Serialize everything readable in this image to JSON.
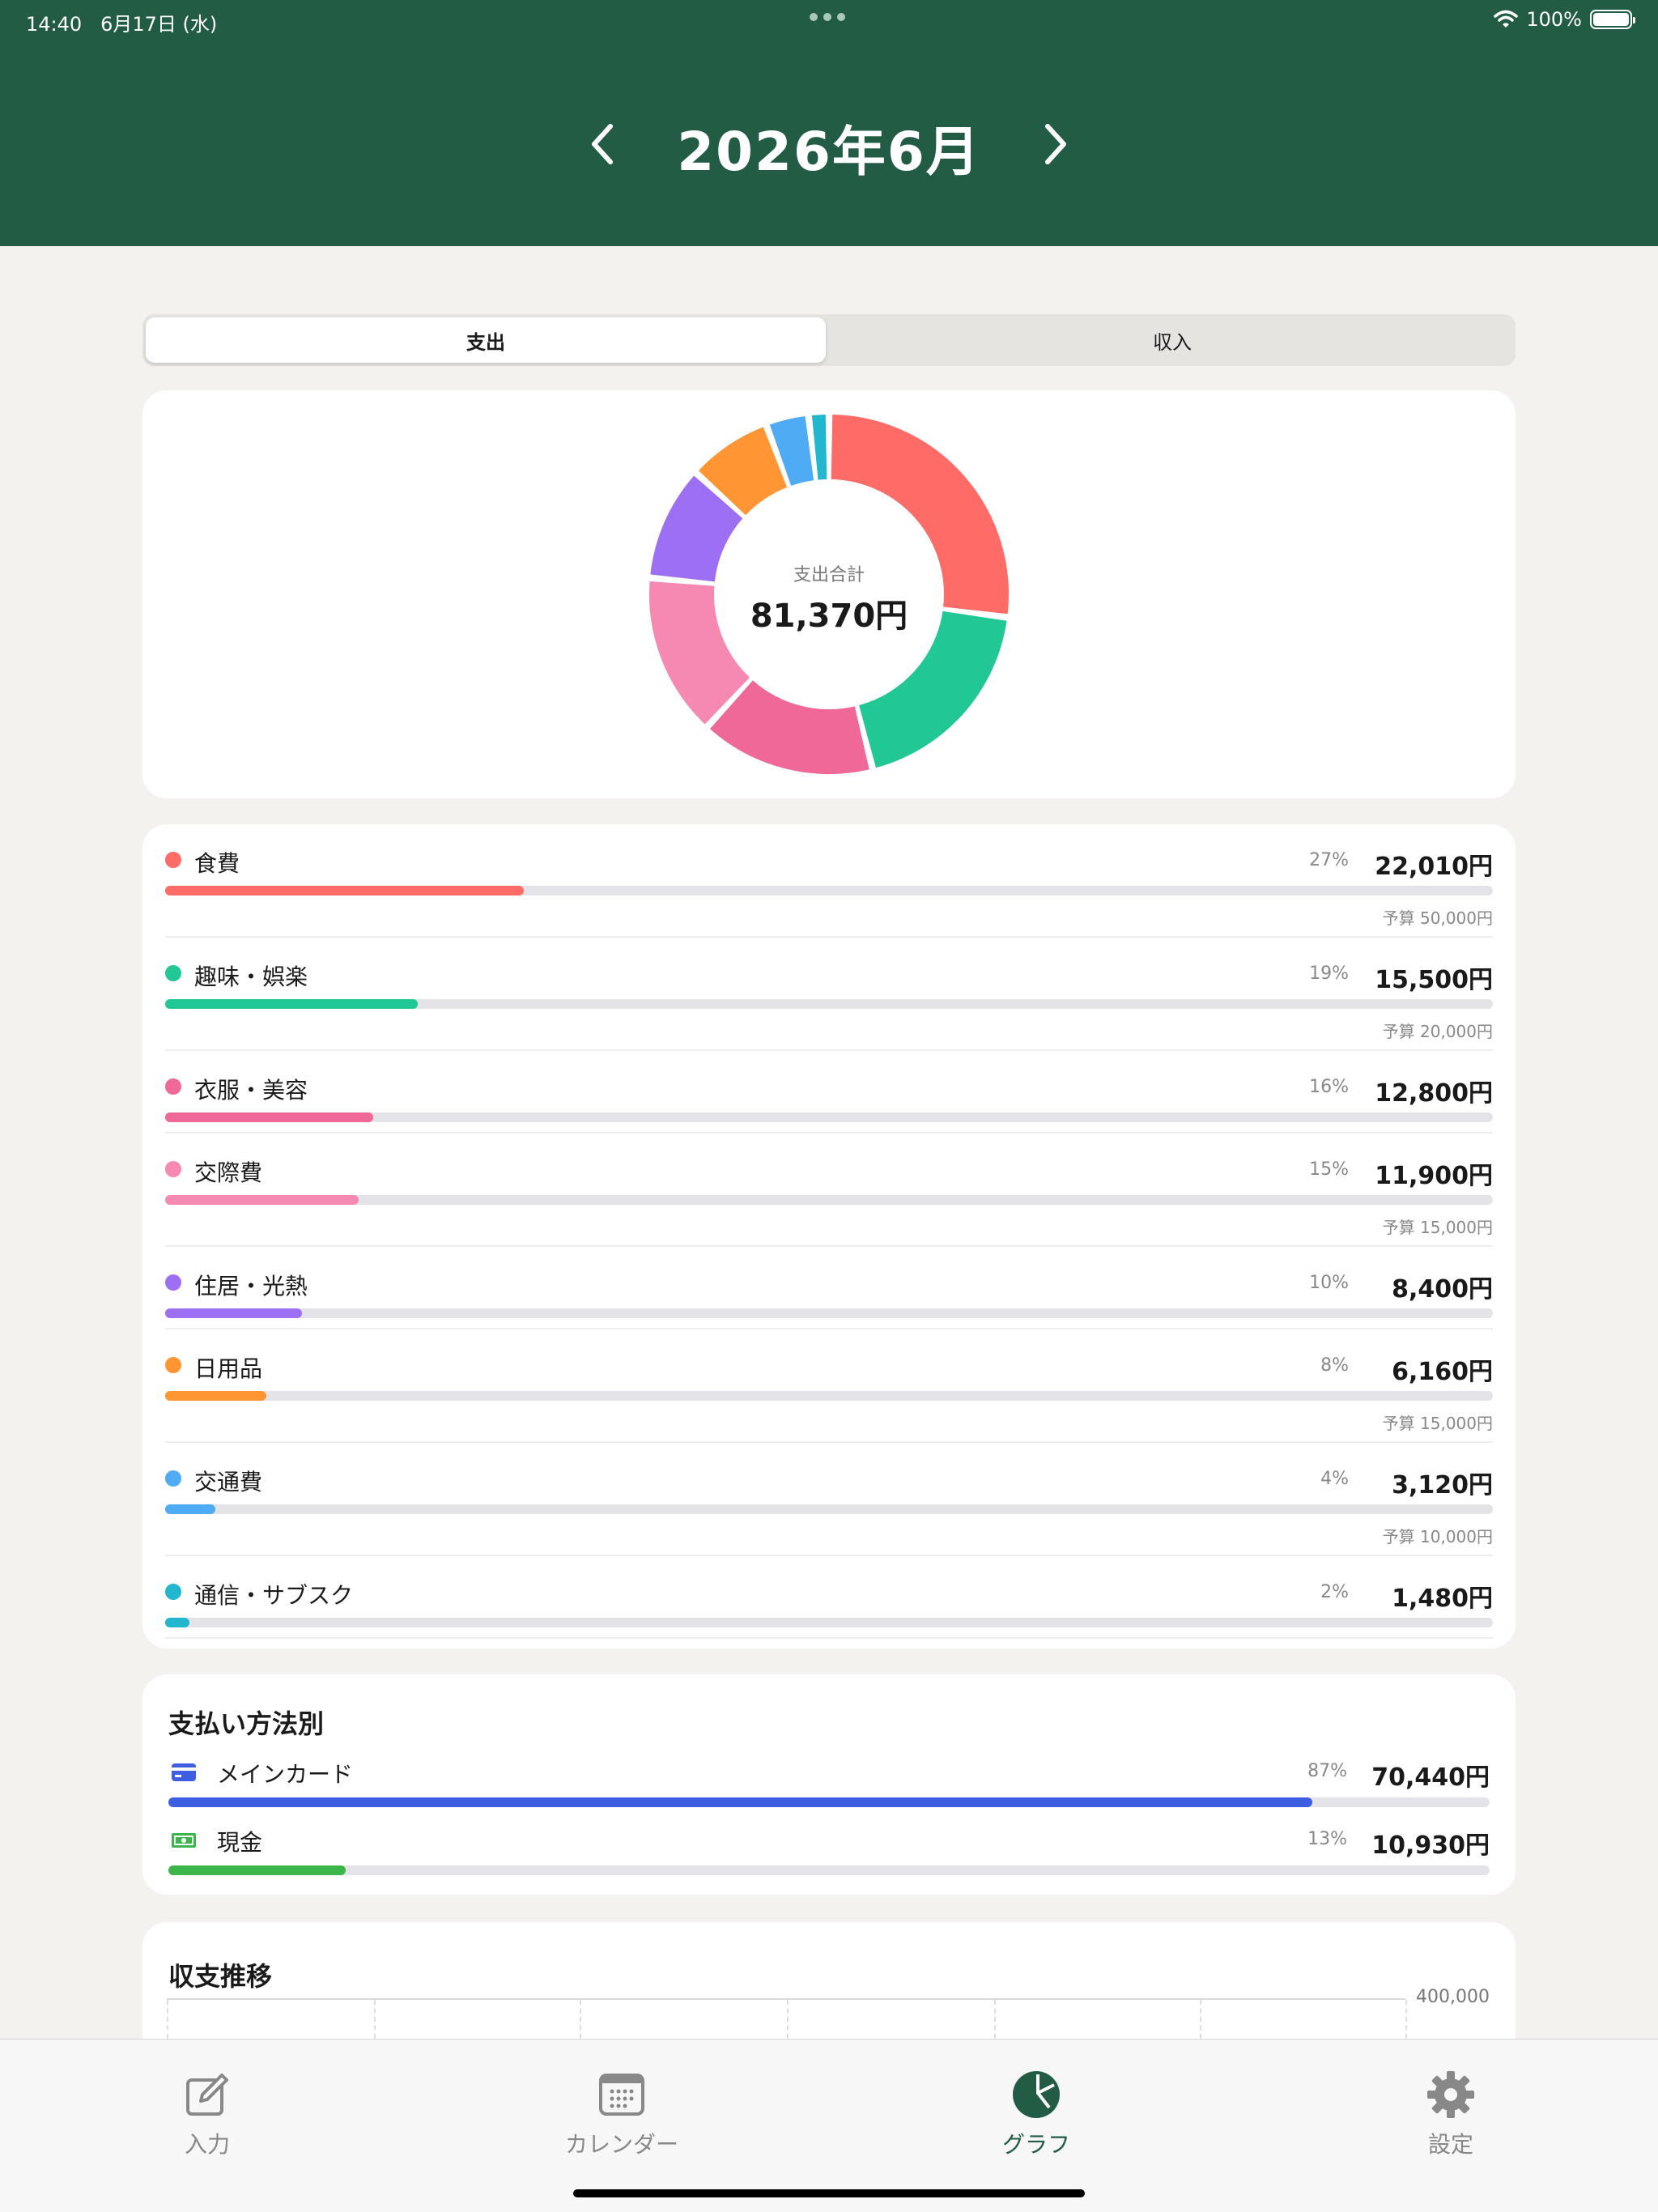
{
  "status": {
    "time": "14:40",
    "date": "6月17日 (水)",
    "battery": "100%"
  },
  "header": {
    "title": "2026年6月"
  },
  "segment": {
    "expense": "支出",
    "income": "収入"
  },
  "donut": {
    "label": "支出合計",
    "total": "81,370円"
  },
  "categories": [
    {
      "name": "食費",
      "pct": "27%",
      "amount": "22,010円",
      "budget": "予算 50,000円",
      "value": 22010,
      "ratio": 0.27,
      "color": "#ff6b66"
    },
    {
      "name": "趣味・娯楽",
      "pct": "19%",
      "amount": "15,500円",
      "budget": "予算 20,000円",
      "value": 15500,
      "ratio": 0.19,
      "color": "#22c796"
    },
    {
      "name": "衣服・美容",
      "pct": "16%",
      "amount": "12,800円",
      "budget": "",
      "value": 12800,
      "ratio": 0.157,
      "color": "#f06898"
    },
    {
      "name": "交際費",
      "pct": "15%",
      "amount": "11,900円",
      "budget": "予算 15,000円",
      "value": 11900,
      "ratio": 0.146,
      "color": "#f589b1"
    },
    {
      "name": "住居・光熱",
      "pct": "10%",
      "amount": "8,400円",
      "budget": "",
      "value": 8400,
      "ratio": 0.103,
      "color": "#9d70f3"
    },
    {
      "name": "日用品",
      "pct": "8%",
      "amount": "6,160円",
      "budget": "予算 15,000円",
      "value": 6160,
      "ratio": 0.076,
      "color": "#ff9533"
    },
    {
      "name": "交通費",
      "pct": "4%",
      "amount": "3,120円",
      "budget": "予算 10,000円",
      "value": 3120,
      "ratio": 0.038,
      "color": "#4fabf3"
    },
    {
      "name": "通信・サブスク",
      "pct": "2%",
      "amount": "1,480円",
      "budget": "",
      "value": 1480,
      "ratio": 0.018,
      "color": "#22b6cf"
    }
  ],
  "payment": {
    "title": "支払い方法別",
    "items": [
      {
        "name": "メインカード",
        "pct": "87%",
        "amount": "70,440円",
        "ratio": 0.866,
        "color": "#3d5ee0",
        "icon": "credit-card-icon"
      },
      {
        "name": "現金",
        "pct": "13%",
        "amount": "10,930円",
        "ratio": 0.134,
        "color": "#3cb64b",
        "icon": "cash-icon"
      }
    ]
  },
  "trend": {
    "title": "収支推移",
    "axis_top": "400,000"
  },
  "tabs": [
    {
      "label": "入力",
      "icon": "edit-icon"
    },
    {
      "label": "カレンダー",
      "icon": "calendar-icon"
    },
    {
      "label": "グラフ",
      "icon": "pie-chart-icon",
      "active": true
    },
    {
      "label": "設定",
      "icon": "gear-icon"
    }
  ]
}
